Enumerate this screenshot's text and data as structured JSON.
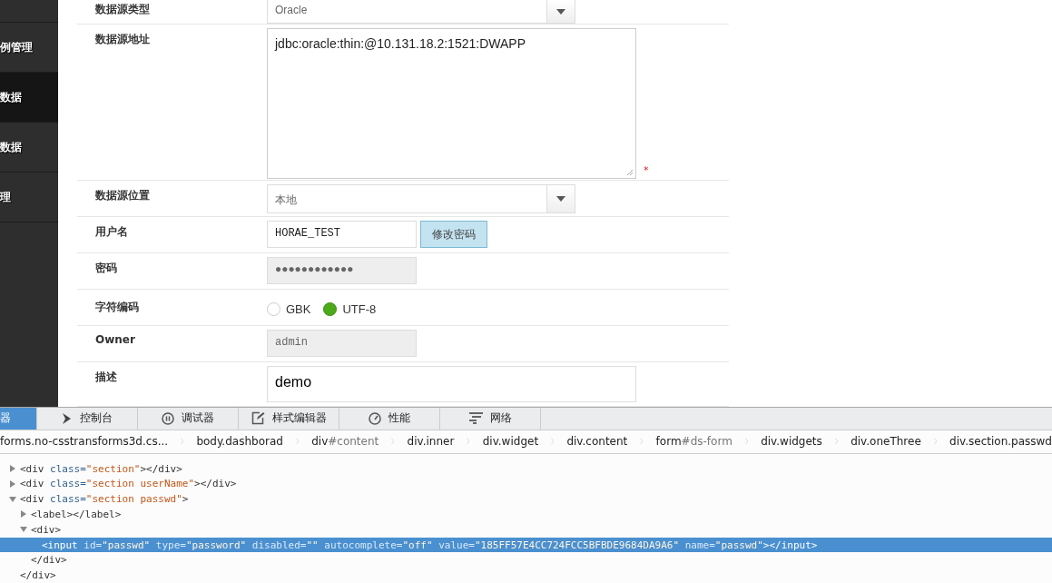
{
  "sidebar": {
    "items": [
      {
        "label": "例管理",
        "selected": false
      },
      {
        "label": "数据",
        "selected": true
      },
      {
        "label": "数据",
        "selected": false
      },
      {
        "label": "理",
        "selected": false
      }
    ]
  },
  "form": {
    "rows": [
      {
        "kind": "select",
        "label": "数据源类型",
        "value": "Oracle"
      },
      {
        "kind": "textarea",
        "label": "数据源地址",
        "value": "jdbc:oracle:thin:@10.131.18.2:1521:DWAPP",
        "required_mark": "*"
      },
      {
        "kind": "select",
        "label": "数据源位置",
        "value": "本地"
      },
      {
        "kind": "input",
        "label": "用户名",
        "value": "HORAE_TEST",
        "disabled": false,
        "button": "修改密码"
      },
      {
        "kind": "input",
        "label": "密码",
        "value": "●●●●●●●●●●●●",
        "disabled": true
      },
      {
        "kind": "radio",
        "label": "字符编码",
        "options": [
          {
            "label": "GBK",
            "selected": false
          },
          {
            "label": "UTF-8",
            "selected": true
          }
        ]
      },
      {
        "kind": "input",
        "label": "Owner",
        "value": "admin",
        "disabled": true
      },
      {
        "kind": "wide",
        "label": "描述",
        "value": "demo"
      }
    ]
  },
  "devtools": {
    "tabs": [
      {
        "label": "器",
        "selected": true
      },
      {
        "label": "控制台",
        "selected": false
      },
      {
        "label": "调试器",
        "selected": false
      },
      {
        "label": "样式编辑器",
        "selected": false
      },
      {
        "label": "性能",
        "selected": false
      },
      {
        "label": "网络",
        "selected": false
      }
    ],
    "breadcrumbs": [
      {
        "tag": "forms.no-csstransforms3d.cs..."
      },
      {
        "tag": "body.dashborad"
      },
      {
        "tag": "div",
        "id": "#content"
      },
      {
        "tag": "div.inner"
      },
      {
        "tag": "div.widget"
      },
      {
        "tag": "div.content"
      },
      {
        "tag": "form",
        "id": "#ds-form"
      },
      {
        "tag": "div.widgets"
      },
      {
        "tag": "div.oneThree"
      },
      {
        "tag": "div.section.passwd"
      }
    ],
    "tree": [
      {
        "kind": "branch",
        "expanded": false,
        "selected": false,
        "tokens": [
          {
            "kind": "tag",
            "text": "<div"
          },
          {
            "kind": "attr",
            "text": " class="
          },
          {
            "kind": "value",
            "text": "\"section\""
          },
          {
            "kind": "tag",
            "text": "></div>"
          }
        ]
      },
      {
        "kind": "branch",
        "expanded": false,
        "selected": false,
        "tokens": [
          {
            "kind": "tag",
            "text": "<div"
          },
          {
            "kind": "attr",
            "text": " class="
          },
          {
            "kind": "value",
            "text": "\"section userName\""
          },
          {
            "kind": "tag",
            "text": "></div>"
          }
        ]
      },
      {
        "kind": "branch",
        "expanded": true,
        "selected": false,
        "tokens": [
          {
            "kind": "tag",
            "text": "<div"
          },
          {
            "kind": "attr",
            "text": " class="
          },
          {
            "kind": "value",
            "text": "\"section passwd\""
          },
          {
            "kind": "tag",
            "text": ">"
          }
        ],
        "children": [
          {
            "kind": "branch",
            "expanded": false,
            "selected": false,
            "tokens": [
              {
                "kind": "tag",
                "text": "<label></label>"
              }
            ]
          },
          {
            "kind": "branch",
            "expanded": true,
            "selected": false,
            "tokens": [
              {
                "kind": "tag",
                "text": "<div>"
              }
            ],
            "children": [
              {
                "kind": "leaf",
                "selected": true,
                "tokens": [
                  {
                    "kind": "tag",
                    "text": "<input"
                  },
                  {
                    "kind": "attr",
                    "text": " id="
                  },
                  {
                    "kind": "value",
                    "text": "\"passwd\""
                  },
                  {
                    "kind": "attr",
                    "text": " type="
                  },
                  {
                    "kind": "value",
                    "text": "\"password\""
                  },
                  {
                    "kind": "attr",
                    "text": " disabled="
                  },
                  {
                    "kind": "value",
                    "text": "\"\""
                  },
                  {
                    "kind": "attr",
                    "text": " autocomplete="
                  },
                  {
                    "kind": "value",
                    "text": "\"off\""
                  },
                  {
                    "kind": "attr",
                    "text": " value="
                  },
                  {
                    "kind": "value",
                    "text": "\"185FF57E4CC724FCC5BFBDE9684DA9A6\""
                  },
                  {
                    "kind": "attr",
                    "text": " name="
                  },
                  {
                    "kind": "value",
                    "text": "\"passwd\""
                  },
                  {
                    "kind": "tag",
                    "text": "></input>"
                  }
                ]
              }
            ],
            "closing": "</div>"
          }
        ],
        "closing": "</div>"
      }
    ]
  }
}
